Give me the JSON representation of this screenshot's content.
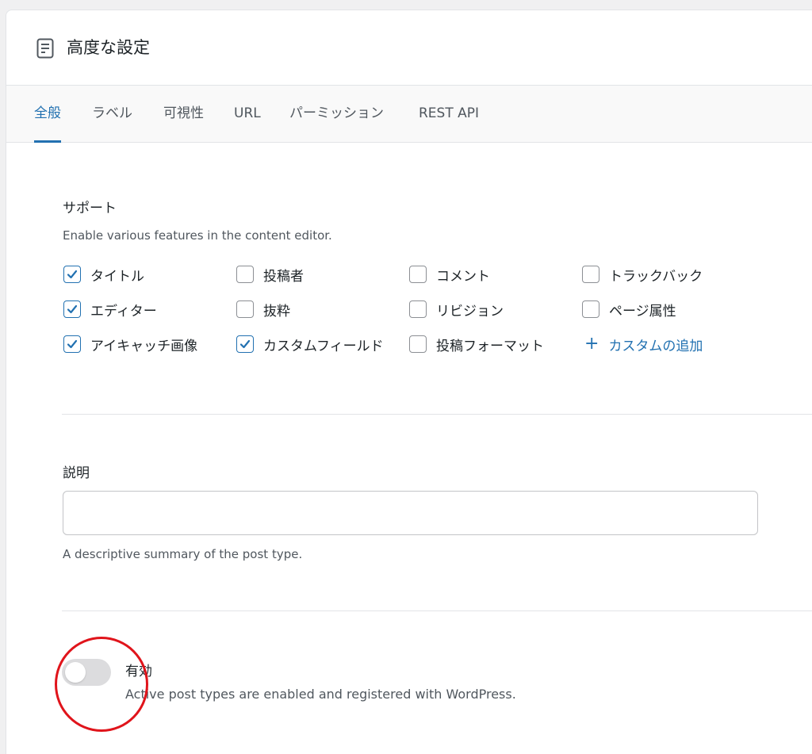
{
  "panel": {
    "icon": "document-icon",
    "title": "高度な設定"
  },
  "tabs": [
    {
      "label": "全般",
      "active": true
    },
    {
      "label": "ラベル",
      "active": false
    },
    {
      "label": "可視性",
      "active": false
    },
    {
      "label": "URL",
      "active": false
    },
    {
      "label": "パーミッション",
      "active": false
    },
    {
      "label": "REST API",
      "active": false
    }
  ],
  "supports": {
    "label": "サポート",
    "help": "Enable various features in the content editor.",
    "items": [
      {
        "label": "タイトル",
        "checked": true
      },
      {
        "label": "投稿者",
        "checked": false
      },
      {
        "label": "コメント",
        "checked": false
      },
      {
        "label": "トラックバック",
        "checked": false
      },
      {
        "label": "エディター",
        "checked": true
      },
      {
        "label": "抜粋",
        "checked": false
      },
      {
        "label": "リビジョン",
        "checked": false
      },
      {
        "label": "ページ属性",
        "checked": false
      },
      {
        "label": "アイキャッチ画像",
        "checked": true
      },
      {
        "label": "カスタムフィールド",
        "checked": true
      },
      {
        "label": "投稿フォーマット",
        "checked": false
      }
    ],
    "add_custom_label": "カスタムの追加",
    "add_custom_icon": "plus-icon"
  },
  "description": {
    "label": "説明",
    "value": "",
    "placeholder": "",
    "help": "A descriptive summary of the post type."
  },
  "active": {
    "label": "有効",
    "enabled": false,
    "help": "Active post types are enabled and registered with WordPress."
  },
  "colors": {
    "accent": "#2271b1",
    "annotation": "#e0141b",
    "toggle_off": "#dcdcde"
  }
}
